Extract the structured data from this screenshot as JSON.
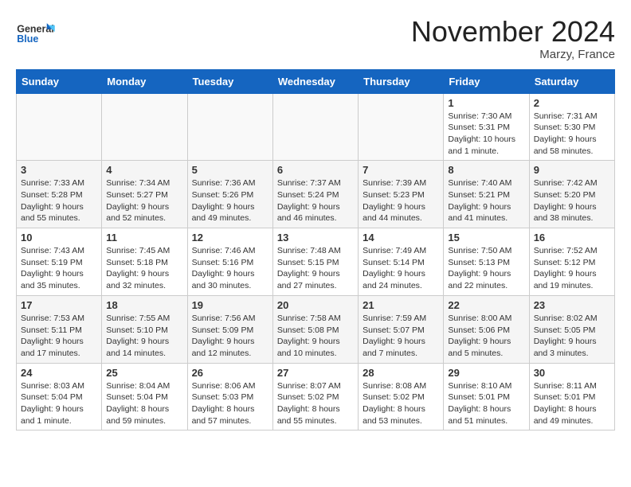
{
  "header": {
    "logo_general": "General",
    "logo_blue": "Blue",
    "month": "November 2024",
    "location": "Marzy, France"
  },
  "weekdays": [
    "Sunday",
    "Monday",
    "Tuesday",
    "Wednesday",
    "Thursday",
    "Friday",
    "Saturday"
  ],
  "weeks": [
    [
      {
        "day": "",
        "info": ""
      },
      {
        "day": "",
        "info": ""
      },
      {
        "day": "",
        "info": ""
      },
      {
        "day": "",
        "info": ""
      },
      {
        "day": "",
        "info": ""
      },
      {
        "day": "1",
        "info": "Sunrise: 7:30 AM\nSunset: 5:31 PM\nDaylight: 10 hours\nand 1 minute."
      },
      {
        "day": "2",
        "info": "Sunrise: 7:31 AM\nSunset: 5:30 PM\nDaylight: 9 hours\nand 58 minutes."
      }
    ],
    [
      {
        "day": "3",
        "info": "Sunrise: 7:33 AM\nSunset: 5:28 PM\nDaylight: 9 hours\nand 55 minutes."
      },
      {
        "day": "4",
        "info": "Sunrise: 7:34 AM\nSunset: 5:27 PM\nDaylight: 9 hours\nand 52 minutes."
      },
      {
        "day": "5",
        "info": "Sunrise: 7:36 AM\nSunset: 5:26 PM\nDaylight: 9 hours\nand 49 minutes."
      },
      {
        "day": "6",
        "info": "Sunrise: 7:37 AM\nSunset: 5:24 PM\nDaylight: 9 hours\nand 46 minutes."
      },
      {
        "day": "7",
        "info": "Sunrise: 7:39 AM\nSunset: 5:23 PM\nDaylight: 9 hours\nand 44 minutes."
      },
      {
        "day": "8",
        "info": "Sunrise: 7:40 AM\nSunset: 5:21 PM\nDaylight: 9 hours\nand 41 minutes."
      },
      {
        "day": "9",
        "info": "Sunrise: 7:42 AM\nSunset: 5:20 PM\nDaylight: 9 hours\nand 38 minutes."
      }
    ],
    [
      {
        "day": "10",
        "info": "Sunrise: 7:43 AM\nSunset: 5:19 PM\nDaylight: 9 hours\nand 35 minutes."
      },
      {
        "day": "11",
        "info": "Sunrise: 7:45 AM\nSunset: 5:18 PM\nDaylight: 9 hours\nand 32 minutes."
      },
      {
        "day": "12",
        "info": "Sunrise: 7:46 AM\nSunset: 5:16 PM\nDaylight: 9 hours\nand 30 minutes."
      },
      {
        "day": "13",
        "info": "Sunrise: 7:48 AM\nSunset: 5:15 PM\nDaylight: 9 hours\nand 27 minutes."
      },
      {
        "day": "14",
        "info": "Sunrise: 7:49 AM\nSunset: 5:14 PM\nDaylight: 9 hours\nand 24 minutes."
      },
      {
        "day": "15",
        "info": "Sunrise: 7:50 AM\nSunset: 5:13 PM\nDaylight: 9 hours\nand 22 minutes."
      },
      {
        "day": "16",
        "info": "Sunrise: 7:52 AM\nSunset: 5:12 PM\nDaylight: 9 hours\nand 19 minutes."
      }
    ],
    [
      {
        "day": "17",
        "info": "Sunrise: 7:53 AM\nSunset: 5:11 PM\nDaylight: 9 hours\nand 17 minutes."
      },
      {
        "day": "18",
        "info": "Sunrise: 7:55 AM\nSunset: 5:10 PM\nDaylight: 9 hours\nand 14 minutes."
      },
      {
        "day": "19",
        "info": "Sunrise: 7:56 AM\nSunset: 5:09 PM\nDaylight: 9 hours\nand 12 minutes."
      },
      {
        "day": "20",
        "info": "Sunrise: 7:58 AM\nSunset: 5:08 PM\nDaylight: 9 hours\nand 10 minutes."
      },
      {
        "day": "21",
        "info": "Sunrise: 7:59 AM\nSunset: 5:07 PM\nDaylight: 9 hours\nand 7 minutes."
      },
      {
        "day": "22",
        "info": "Sunrise: 8:00 AM\nSunset: 5:06 PM\nDaylight: 9 hours\nand 5 minutes."
      },
      {
        "day": "23",
        "info": "Sunrise: 8:02 AM\nSunset: 5:05 PM\nDaylight: 9 hours\nand 3 minutes."
      }
    ],
    [
      {
        "day": "24",
        "info": "Sunrise: 8:03 AM\nSunset: 5:04 PM\nDaylight: 9 hours\nand 1 minute."
      },
      {
        "day": "25",
        "info": "Sunrise: 8:04 AM\nSunset: 5:04 PM\nDaylight: 8 hours\nand 59 minutes."
      },
      {
        "day": "26",
        "info": "Sunrise: 8:06 AM\nSunset: 5:03 PM\nDaylight: 8 hours\nand 57 minutes."
      },
      {
        "day": "27",
        "info": "Sunrise: 8:07 AM\nSunset: 5:02 PM\nDaylight: 8 hours\nand 55 minutes."
      },
      {
        "day": "28",
        "info": "Sunrise: 8:08 AM\nSunset: 5:02 PM\nDaylight: 8 hours\nand 53 minutes."
      },
      {
        "day": "29",
        "info": "Sunrise: 8:10 AM\nSunset: 5:01 PM\nDaylight: 8 hours\nand 51 minutes."
      },
      {
        "day": "30",
        "info": "Sunrise: 8:11 AM\nSunset: 5:01 PM\nDaylight: 8 hours\nand 49 minutes."
      }
    ]
  ]
}
